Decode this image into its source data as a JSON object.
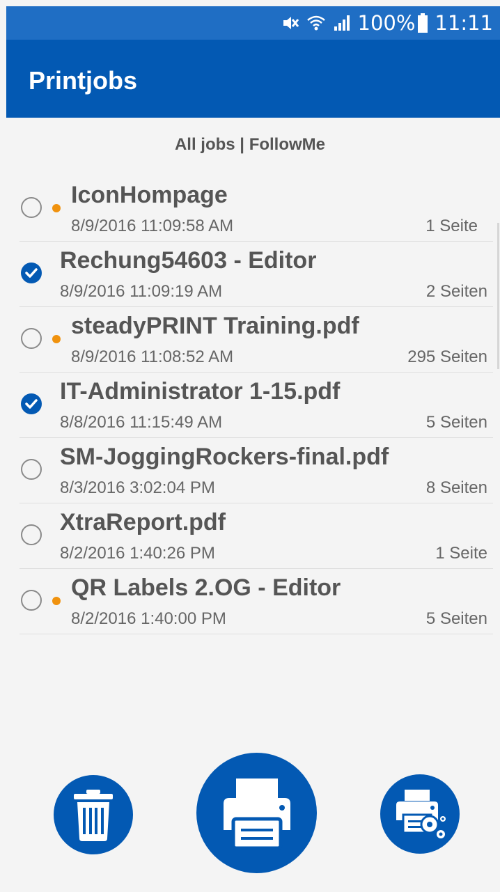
{
  "status_bar": {
    "battery": "100%",
    "time": "11:11",
    "icons": [
      "mute-icon",
      "wifi-icon",
      "signal-icon",
      "battery-icon"
    ]
  },
  "app_bar": {
    "title": "Printjobs"
  },
  "filter": {
    "label": "All jobs | FollowMe"
  },
  "jobs": [
    {
      "name": "IconHompage",
      "date": "8/9/2016 11:09:58 AM",
      "pages": "1 Seite",
      "checked": false,
      "dot": true
    },
    {
      "name": "Rechung54603 - Editor",
      "date": "8/9/2016 11:09:19 AM",
      "pages": "2 Seiten",
      "checked": true,
      "dot": false
    },
    {
      "name": "steadyPRINT Training.pdf",
      "date": "8/9/2016 11:08:52 AM",
      "pages": "295 Seiten",
      "checked": false,
      "dot": true
    },
    {
      "name": "IT-Administrator 1-15.pdf",
      "date": "8/8/2016 11:15:49 AM",
      "pages": "5 Seiten",
      "checked": true,
      "dot": false
    },
    {
      "name": "SM-JoggingRockers-final.pdf",
      "date": "8/3/2016 3:02:04 PM",
      "pages": "8 Seiten",
      "checked": false,
      "dot": false
    },
    {
      "name": "XtraReport.pdf",
      "date": "8/2/2016 1:40:26 PM",
      "pages": "1 Seite",
      "checked": false,
      "dot": false
    },
    {
      "name": "QR Labels 2.OG - Editor",
      "date": "8/2/2016 1:40:00 PM",
      "pages": "5 Seiten",
      "checked": false,
      "dot": true
    }
  ],
  "actions": [
    {
      "name": "delete-button",
      "icon": "trash-icon"
    },
    {
      "name": "print-button",
      "icon": "printer-icon"
    },
    {
      "name": "printer-settings-button",
      "icon": "printer-settings-icon"
    }
  ],
  "colors": {
    "primary": "#0359b3",
    "status_bar": "#1f6ec4",
    "pending_dot": "#f0920e",
    "background": "#f4f4f4"
  }
}
